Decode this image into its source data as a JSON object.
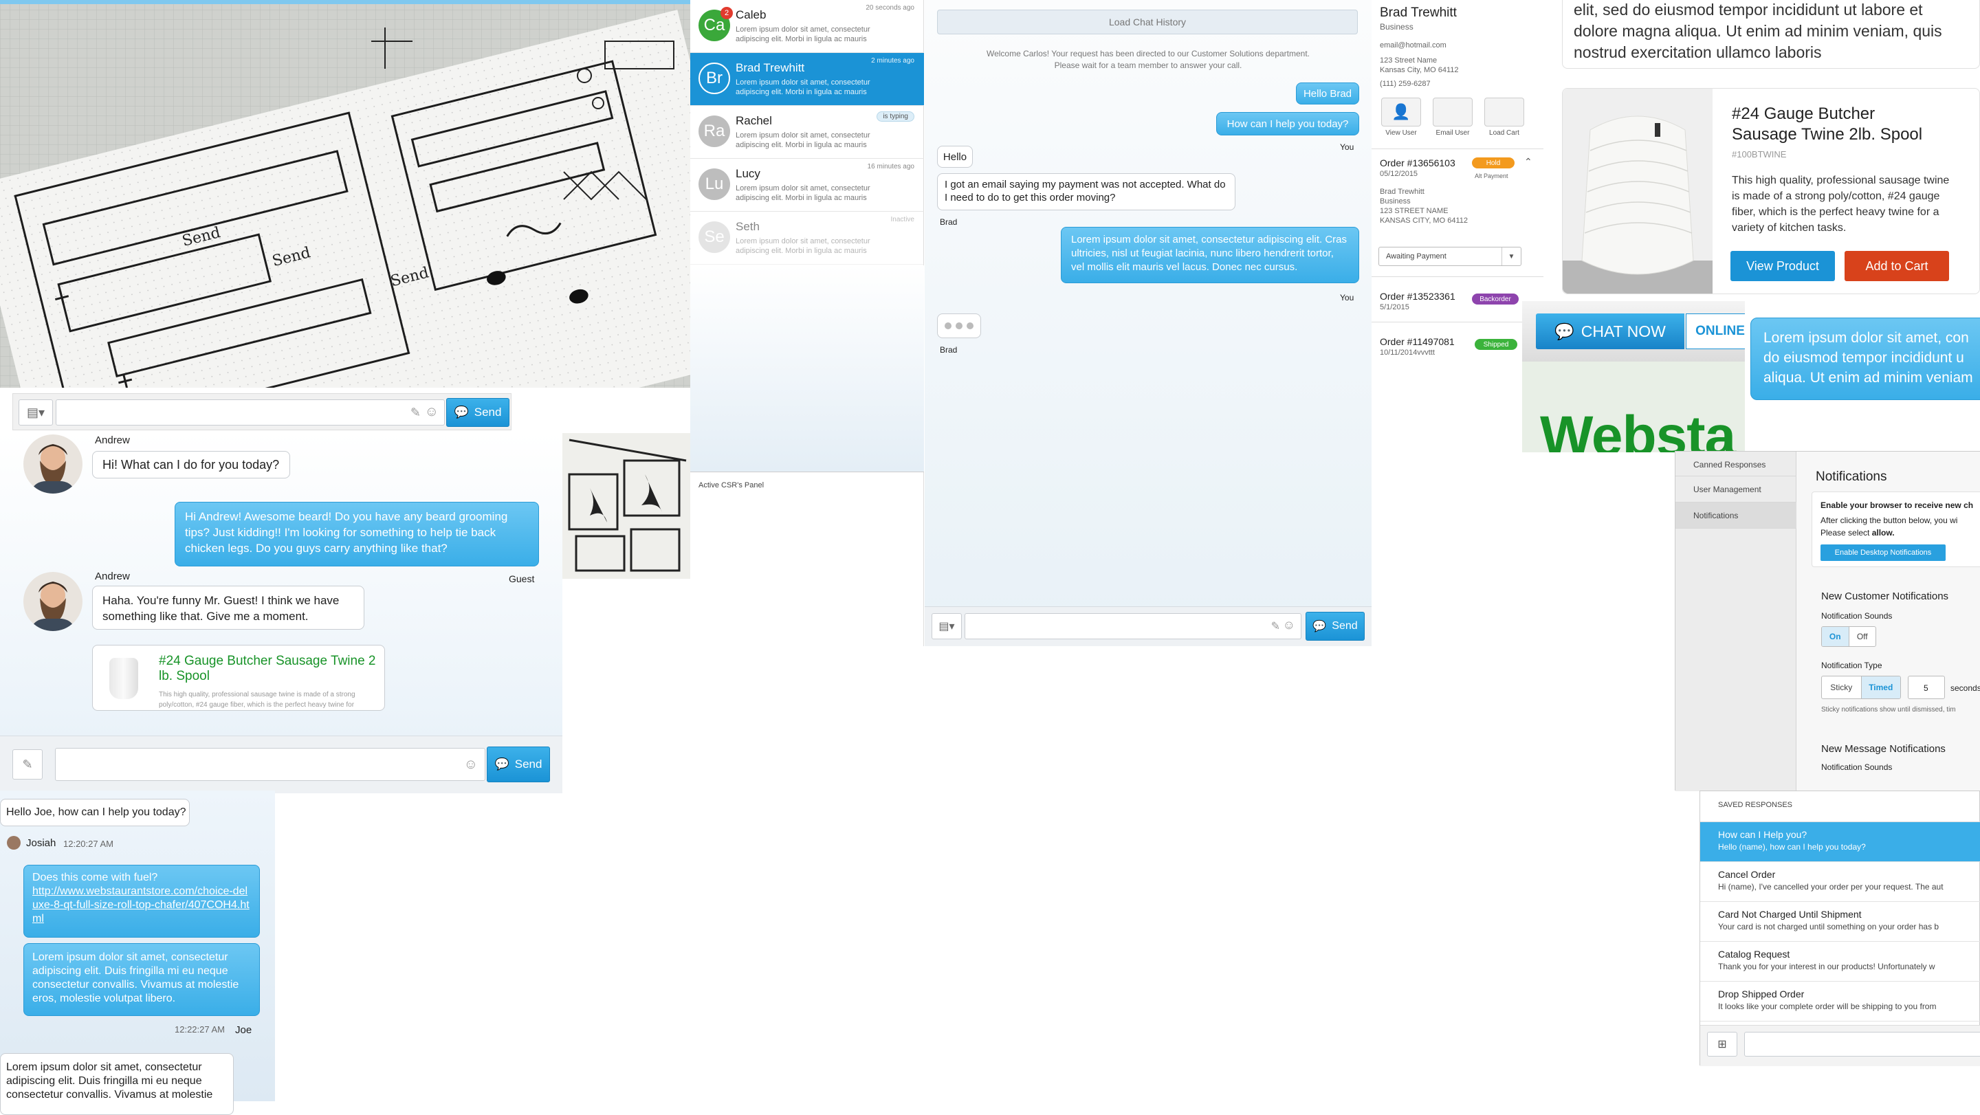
{
  "sketch": {
    "send_label_1": "Send",
    "send_label_2": "Send",
    "send_label_3": "Send",
    "composer": {
      "send_label": "Send"
    }
  },
  "csr_list": {
    "items": [
      {
        "initials": "Ca",
        "name": "Caleb",
        "time": "20 seconds ago",
        "preview": "Lorem ipsum dolor sit amet, consectetur adipiscing elit. Morbi in ligula ac mauris",
        "badge": "2",
        "color": "#3aa83a"
      },
      {
        "initials": "Br",
        "name": "Brad Trewhitt",
        "time": "2 minutes ago",
        "preview": "Lorem ipsum dolor sit amet, consectetur adipiscing elit. Morbi in ligula ac mauris",
        "color": "#1f95d6"
      },
      {
        "initials": "Ra",
        "name": "Rachel",
        "status": "is typing",
        "preview": "Lorem ipsum dolor sit amet, consectetur adipiscing elit. Morbi in ligula ac mauris",
        "color": "#bdbdbd"
      },
      {
        "initials": "Lu",
        "name": "Lucy",
        "time": "16 minutes ago",
        "preview": "Lorem ipsum dolor sit amet, consectetur adipiscing elit. Morbi in ligula ac mauris",
        "color": "#bdbdbd"
      },
      {
        "initials": "Se",
        "name": "Seth",
        "time": "Inactive",
        "preview": "Lorem ipsum dolor sit amet, consectetur adipiscing elit. Morbi in ligula ac mauris",
        "color": "#d6d6d6"
      }
    ],
    "footer": "Active CSR's Panel"
  },
  "main_chat": {
    "load_history": "Load Chat History",
    "welcome": "Welcome Carlos! Your request has been directed to our Customer Solutions department. Please wait for a team member to answer your call.",
    "msg_hello_brad": "Hello Brad",
    "msg_how_help": "How can I help you today?",
    "you_1": "You",
    "msg_hello": "Hello",
    "msg_payment": "I got an email saying my payment was not accepted. What do I need to do to get this order moving?",
    "brad_1": "Brad",
    "msg_lorem": "Lorem ipsum dolor sit amet, consectetur adipiscing elit. Cras ultricies, nisl ut feugiat lacinia, nunc libero hendrerit tortor, vel mollis elit mauris vel lacus. Donec nec cursus.",
    "you_2": "You",
    "brad_2": "Brad",
    "send_label": "Send"
  },
  "customer": {
    "name": "Brad Trewhitt",
    "type": "Business",
    "email": "email@hotmail.com",
    "street": "123 Street Name",
    "city": "Kansas City, MO 64112",
    "phone": "(111) 259-6287",
    "actions": [
      "View User",
      "Email User",
      "Load Cart"
    ],
    "orders": [
      {
        "number": "Order #13656103",
        "date": "05/12/2015",
        "badge": "Hold",
        "badge_color": "#f39a1e",
        "sub": "Alt Payment"
      },
      {
        "number": "Order #13523361",
        "date": "5/1/2015",
        "badge": "Backorder",
        "badge_color": "#8e44ad"
      },
      {
        "number": "Order #11497081",
        "date": "10/11/2014vvvttt",
        "badge": "Shipped",
        "badge_color": "#3bb33b"
      }
    ],
    "order_detail": {
      "name": "Brad Trewhitt",
      "type": "Business",
      "street": "123 STREET NAME",
      "city": "KANSAS CITY, MO 64112",
      "status_select": "Awaiting Payment"
    }
  },
  "top_right_text": "elit, sed do eiusmod tempor incididunt ut labore et dolore magna aliqua. Ut enim ad minim veniam, quis nostrud exercitation ullamco laboris",
  "product": {
    "title": "#24 Gauge Butcher Sausage Twine 2lb. Spool",
    "sku": "#100BTWINE",
    "description": "This high quality, professional sausage twine is made of a strong poly/cotton, #24 gauge fiber, which is the perfect heavy twine for a variety of kitchen tasks.",
    "view_label": "View Product",
    "cart_label": "Add to Cart"
  },
  "chat_now": {
    "label": "CHAT NOW",
    "status": "ONLINE",
    "logo_text": "Websta"
  },
  "blue_teaser": "Lorem ipsum dolor sit amet, con do eiusmod tempor incididunt u aliqua. Ut enim ad minim veniam",
  "notifications": {
    "nav": [
      "Canned Responses",
      "User Management",
      "Notifications"
    ],
    "title": "Notifications",
    "enable_heading": "Enable your browser to receive new ch",
    "enable_text_1": "After clicking the button below, you wi",
    "enable_text_2": "Please select",
    "enable_text_2b": "allow.",
    "enable_button": "Enable Desktop Notifications",
    "new_customer": "New Customer Notifications",
    "sounds_label": "Notification Sounds",
    "on": "On",
    "off": "Off",
    "type_label": "Notification Type",
    "sticky": "Sticky",
    "timed": "Timed",
    "seconds_value": "5",
    "seconds_label": "seconds",
    "type_help": "Sticky notifications show until dismissed, tim",
    "new_message": "New Message Notifications",
    "sounds_label_2": "Notification Sounds"
  },
  "saved_responses": {
    "header": "SAVED RESPONSES",
    "items": [
      {
        "title": "How can I Help you?",
        "text": "Hello (name), how can I help you today?"
      },
      {
        "title": "Cancel Order",
        "text": "Hi (name), I've cancelled your order per your request. The aut"
      },
      {
        "title": "Card Not Charged Until Shipment",
        "text": "Your card is not charged until something on your order has b"
      },
      {
        "title": "Catalog Request",
        "text": "Thank you for your interest in our products! Unfortunately w"
      },
      {
        "title": "Drop Shipped Order",
        "text": "It looks like your complete order will be shipping to you from"
      }
    ]
  },
  "andrew_chat": {
    "agent": "Andrew",
    "msg1": "Hi! What can I do for you today?",
    "msg2": "Hi Andrew! Awesome beard! Do you have any beard grooming tips? Just kidding!! I'm looking for something to help tie back chicken legs. Do you guys carry anything like that?",
    "guest": "Guest",
    "agent2": "Andrew",
    "msg3": "Haha. You're funny Mr. Guest! I think we have something like that. Give me a moment.",
    "product_title": "#24 Gauge Butcher Sausage Twine 2 lb. Spool",
    "product_desc": "This high quality, professional sausage twine is made of a strong poly/cotton, #24 gauge fiber, which is the perfect heavy twine for",
    "send_label": "Send"
  },
  "josiah_chat": {
    "msg1": "Hello Joe, how can I help you today?",
    "agent": "Josiah",
    "time1": "12:20:27 AM",
    "q": "Does this come with fuel?",
    "link": "http://www.webstaurantstore.com/choice-deluxe-8-qt-full-size-roll-top-chafer/407COH4.html",
    "msg3": "Lorem ipsum dolor sit amet, consectetur adipiscing elit. Duis fringilla mi eu neque consectetur convallis. Vivamus at molestie eros, molestie volutpat libero.",
    "time2": "12:22:27 AM",
    "user": "Joe",
    "msg4": "Lorem ipsum dolor sit amet, consectetur adipiscing elit. Duis fringilla mi eu neque consectetur convallis. Vivamus at molestie"
  }
}
